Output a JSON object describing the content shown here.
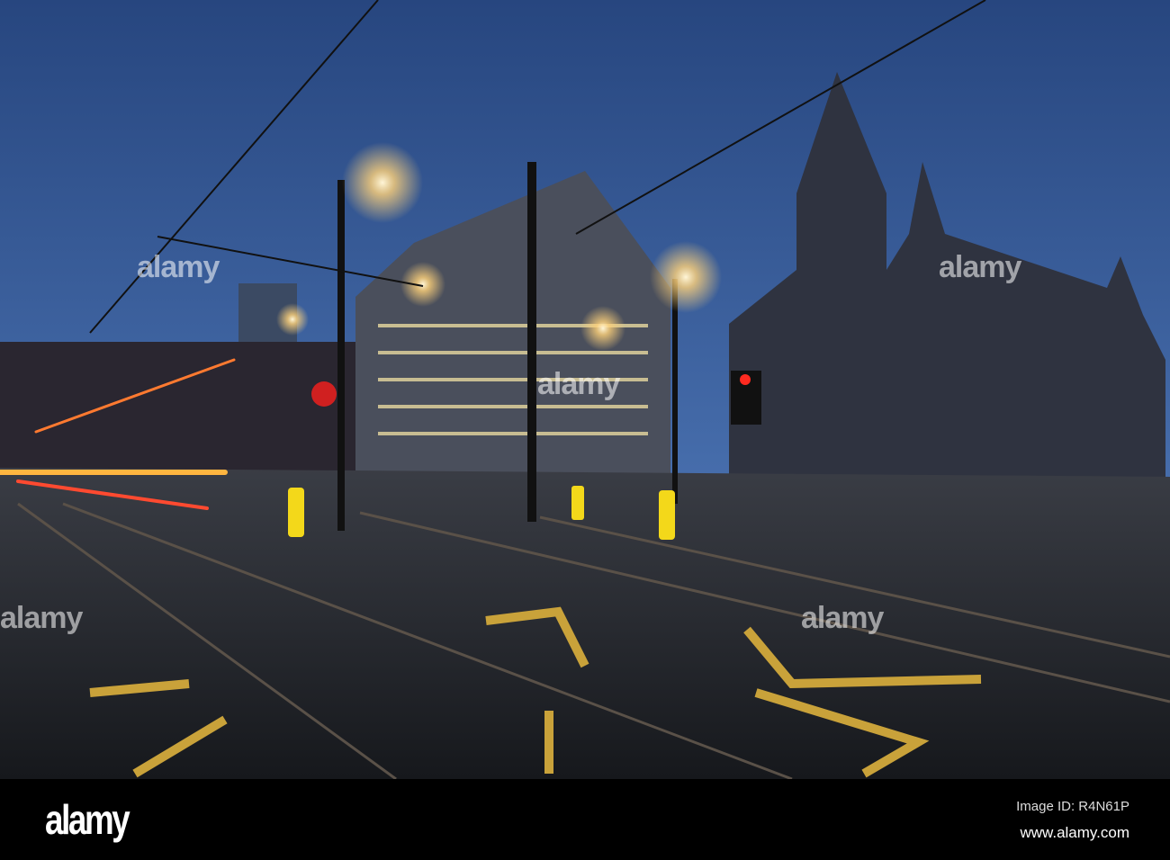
{
  "photo": {
    "subject": "Manchester Town Hall at dusk, wet street with tram tracks",
    "colors": {
      "sky_top": "#2c4f8f",
      "sky_bottom": "#4f7fc6",
      "road": "#1d2026",
      "lamp": "#ffd27a",
      "markings": "#c9a23a"
    }
  },
  "watermark": {
    "text": "alamy"
  },
  "footer": {
    "logo": "alamy",
    "image_id": "Image ID: R4N61P",
    "url": "www.alamy.com"
  }
}
